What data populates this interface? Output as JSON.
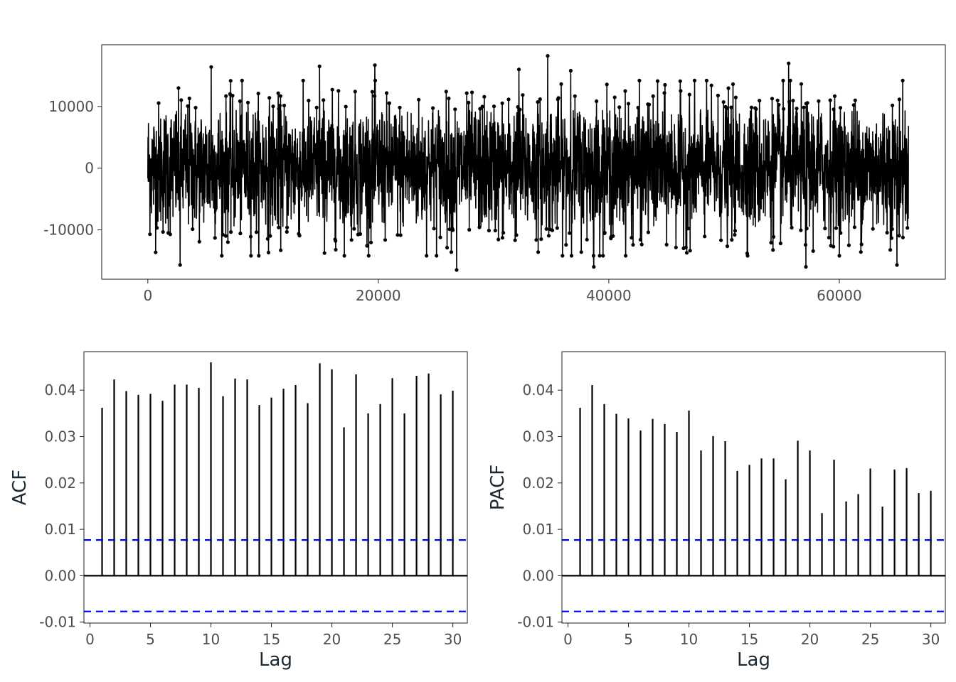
{
  "chart_data": [
    {
      "type": "line",
      "panel": "series",
      "title": "",
      "xlabel": "",
      "ylabel": "",
      "xlim": [
        -4000,
        69200
      ],
      "ylim": [
        -18000,
        20000
      ],
      "x_ticks": [
        0,
        20000,
        40000,
        60000
      ],
      "x_tick_labels": [
        "0",
        "20000",
        "40000",
        "60000"
      ],
      "y_ticks": [
        -10000,
        0,
        10000
      ],
      "y_tick_labels": [
        "-10000",
        "0",
        "10000"
      ],
      "n_points": 66000,
      "approx_range": [
        -16500,
        18200
      ],
      "markers": "points",
      "color": "#000000",
      "notable_points": [
        {
          "x": 2800,
          "y": -15700
        },
        {
          "x": 5500,
          "y": 16400
        },
        {
          "x": 14900,
          "y": 16500
        },
        {
          "x": 19700,
          "y": 16700
        },
        {
          "x": 26800,
          "y": -16500
        },
        {
          "x": 32200,
          "y": 16000
        },
        {
          "x": 34700,
          "y": 18200
        },
        {
          "x": 36700,
          "y": 15800
        },
        {
          "x": 38700,
          "y": -16000
        },
        {
          "x": 55600,
          "y": 17000
        },
        {
          "x": 57100,
          "y": -16000
        },
        {
          "x": 65000,
          "y": -15700
        }
      ],
      "grid": false
    },
    {
      "type": "bar",
      "panel": "acf",
      "title": "",
      "xlabel": "Lag",
      "ylabel": "ACF",
      "xlim": [
        -0.5,
        31.2
      ],
      "ylim": [
        -0.0102,
        0.0483
      ],
      "x_ticks": [
        0,
        5,
        10,
        15,
        20,
        25,
        30
      ],
      "x_tick_labels": [
        "0",
        "5",
        "10",
        "15",
        "20",
        "25",
        "30"
      ],
      "y_ticks": [
        -0.01,
        0,
        0.01,
        0.02,
        0.03,
        0.04
      ],
      "y_tick_labels": [
        "-0.01",
        "0.00",
        "0.01",
        "0.02",
        "0.03",
        "0.04"
      ],
      "lags": [
        1,
        2,
        3,
        4,
        5,
        6,
        7,
        8,
        9,
        10,
        11,
        12,
        13,
        14,
        15,
        16,
        17,
        18,
        19,
        20,
        21,
        22,
        23,
        24,
        25,
        26,
        27,
        28,
        29,
        30
      ],
      "values": [
        0.0362,
        0.0423,
        0.0398,
        0.039,
        0.0392,
        0.0377,
        0.0412,
        0.0412,
        0.0405,
        0.046,
        0.0387,
        0.0425,
        0.0423,
        0.0368,
        0.0384,
        0.0403,
        0.0411,
        0.0372,
        0.0458,
        0.0445,
        0.032,
        0.0434,
        0.035,
        0.037,
        0.0426,
        0.035,
        0.0431,
        0.0436,
        0.0391,
        0.0399
      ],
      "confidence_band": 0.0077,
      "band_color": "#0000ee",
      "grid": false
    },
    {
      "type": "bar",
      "panel": "pacf",
      "title": "",
      "xlabel": "Lag",
      "ylabel": "PACF",
      "xlim": [
        -0.5,
        31.2
      ],
      "ylim": [
        -0.0102,
        0.0483
      ],
      "x_ticks": [
        0,
        5,
        10,
        15,
        20,
        25,
        30
      ],
      "x_tick_labels": [
        "0",
        "5",
        "10",
        "15",
        "20",
        "25",
        "30"
      ],
      "y_ticks": [
        -0.01,
        0,
        0.01,
        0.02,
        0.03,
        0.04
      ],
      "y_tick_labels": [
        "-0.01",
        "0.00",
        "0.01",
        "0.02",
        "0.03",
        "0.04"
      ],
      "lags": [
        1,
        2,
        3,
        4,
        5,
        6,
        7,
        8,
        9,
        10,
        11,
        12,
        13,
        14,
        15,
        16,
        17,
        18,
        19,
        20,
        21,
        22,
        23,
        24,
        25,
        26,
        27,
        28,
        29,
        30
      ],
      "values": [
        0.0362,
        0.0411,
        0.037,
        0.0349,
        0.0339,
        0.0313,
        0.0338,
        0.0327,
        0.031,
        0.0356,
        0.027,
        0.0301,
        0.029,
        0.0226,
        0.0239,
        0.0253,
        0.0253,
        0.0208,
        0.0291,
        0.027,
        0.0135,
        0.025,
        0.016,
        0.0176,
        0.0231,
        0.0149,
        0.0229,
        0.0232,
        0.0178,
        0.0183
      ],
      "confidence_band": 0.0077,
      "band_color": "#0000ee",
      "grid": false
    }
  ]
}
